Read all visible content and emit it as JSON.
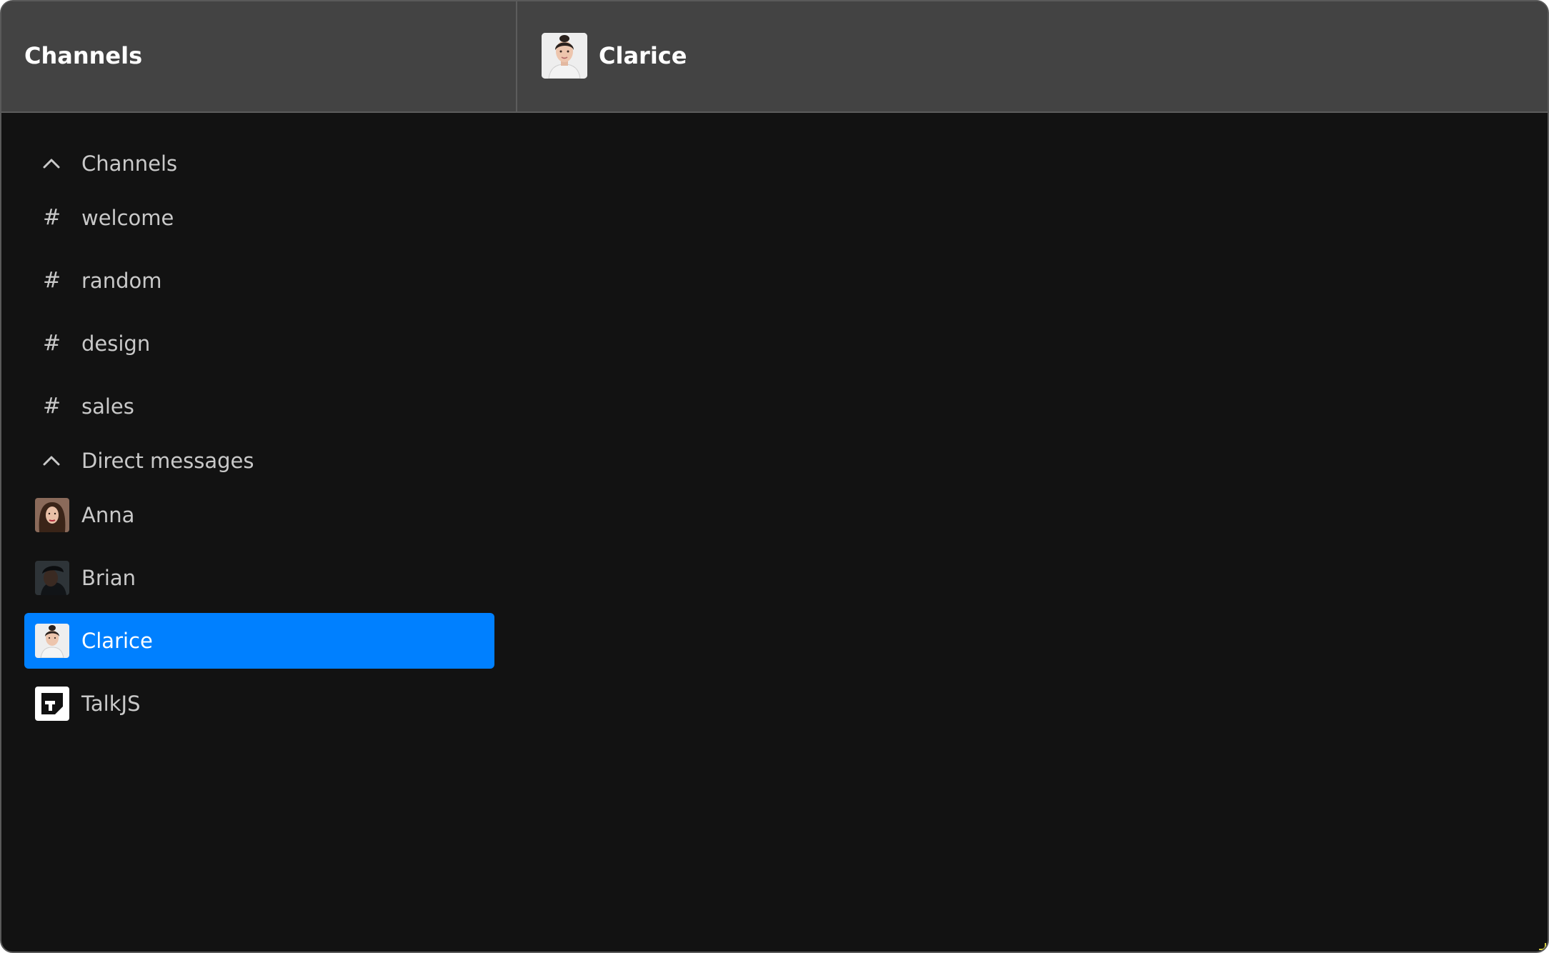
{
  "header": {
    "title": "Channels",
    "chat_name": "Clarice"
  },
  "sidebar": {
    "channels_section": {
      "label": "Channels",
      "icon": "chevron-up-icon"
    },
    "channels": [
      {
        "label": "welcome",
        "icon": "hash-icon"
      },
      {
        "label": "random",
        "icon": "hash-icon"
      },
      {
        "label": "design",
        "icon": "hash-icon"
      },
      {
        "label": "sales",
        "icon": "hash-icon"
      }
    ],
    "dm_section": {
      "label": "Direct messages",
      "icon": "chevron-up-icon"
    },
    "direct_messages": [
      {
        "label": "Anna",
        "active": false
      },
      {
        "label": "Brian",
        "active": false
      },
      {
        "label": "Clarice",
        "active": true
      },
      {
        "label": "TalkJS",
        "active": false
      }
    ]
  },
  "colors": {
    "accent": "#0080ff",
    "background": "#121212",
    "header": "#434343"
  }
}
